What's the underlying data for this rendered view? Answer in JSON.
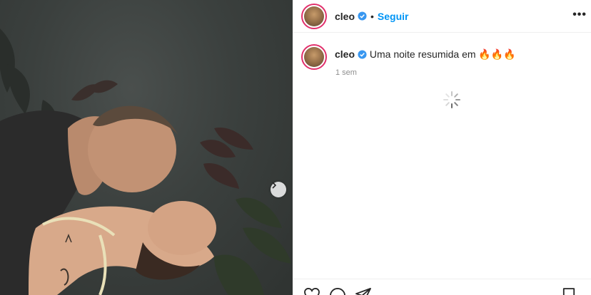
{
  "post": {
    "username": "cleo",
    "verified": true,
    "separator": "•",
    "follow_label": "Seguir",
    "more_label": "•••"
  },
  "caption": {
    "username": "cleo",
    "text": "Uma noite resumida em",
    "emoji": "🔥🔥🔥",
    "time": "1 sem"
  },
  "icons": {
    "next": "chevron-right-icon",
    "like": "heart-icon",
    "comment": "comment-icon",
    "share": "share-icon",
    "save": "bookmark-icon",
    "verified": "verified-badge-icon",
    "loading": "loading-spinner-icon"
  },
  "colors": {
    "accent": "#0095f6",
    "verified": "#3897f0",
    "avatar_ring": "#e1306c",
    "muted": "#8e8e8e"
  }
}
